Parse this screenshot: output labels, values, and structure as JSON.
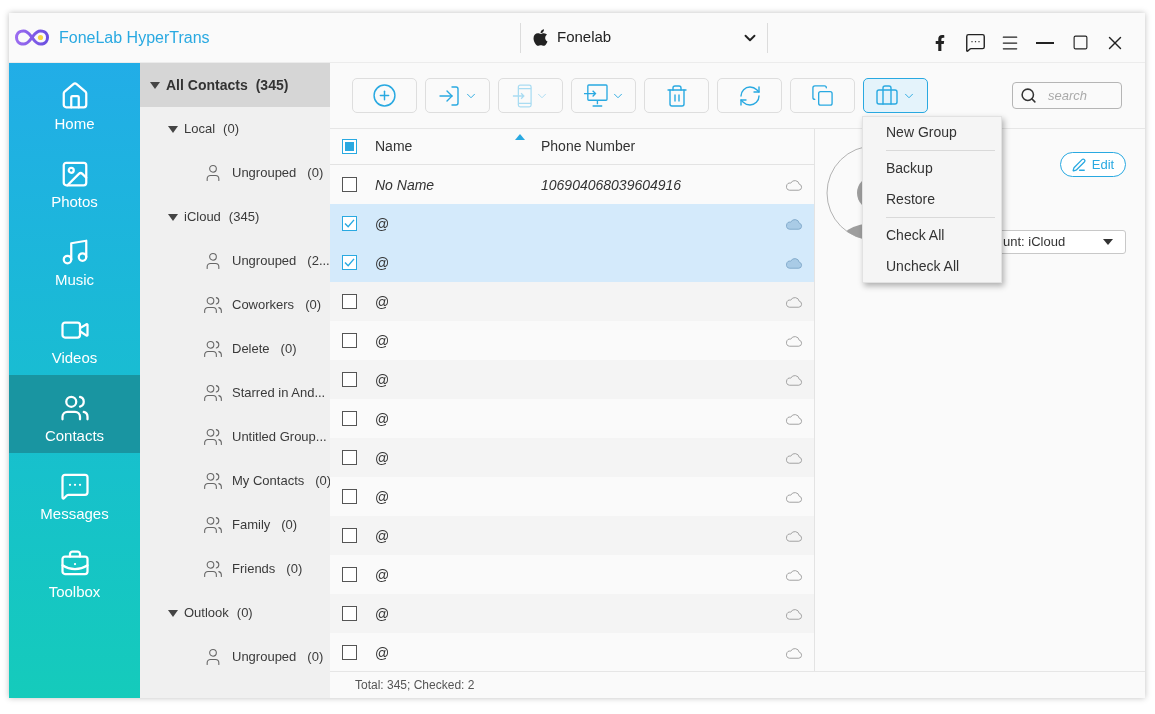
{
  "window": {
    "title": "FoneLab HyperTrans"
  },
  "device": {
    "name": "Fonelab"
  },
  "nav": [
    {
      "label": "Home",
      "selected": false
    },
    {
      "label": "Photos",
      "selected": false
    },
    {
      "label": "Music",
      "selected": false
    },
    {
      "label": "Videos",
      "selected": false
    },
    {
      "label": "Contacts",
      "selected": true
    },
    {
      "label": "Messages",
      "selected": false
    },
    {
      "label": "Toolbox",
      "selected": false
    }
  ],
  "groups": [
    {
      "label": "All Contacts",
      "count": "(345)",
      "selected": true,
      "expanded": true,
      "children": [
        {
          "label": "Local",
          "count": "(0)",
          "selected": false,
          "expanded": true,
          "children": [
            {
              "label": "Ungrouped",
              "count": "(0)",
              "kind": "ungrouped",
              "selected": false
            }
          ]
        },
        {
          "label": "iCloud",
          "count": "(345)",
          "selected": false,
          "expanded": true,
          "children": [
            {
              "label": "Ungrouped",
              "count": "(2...",
              "kind": "ungrouped",
              "selected": false
            },
            {
              "label": "Coworkers",
              "count": "(0)",
              "kind": "group",
              "selected": false
            },
            {
              "label": "Delete",
              "count": "(0)",
              "kind": "group",
              "selected": false
            },
            {
              "label": "Starred in And...",
              "kind": "group",
              "selected": false
            },
            {
              "label": "Untitled Group...",
              "kind": "group",
              "selected": false
            },
            {
              "label": "My Contacts",
              "count": "(0)",
              "kind": "group",
              "selected": false
            },
            {
              "label": "Family",
              "count": "(0)",
              "kind": "group",
              "selected": false
            },
            {
              "label": "Friends",
              "count": "(0)",
              "kind": "group",
              "selected": false
            }
          ]
        },
        {
          "label": "Outlook",
          "count": "(0)",
          "selected": false,
          "expanded": true,
          "children": [
            {
              "label": "Ungrouped",
              "count": "(0)",
              "kind": "ungrouped",
              "selected": false
            }
          ]
        }
      ]
    }
  ],
  "toolbar": {
    "buttons": [
      {
        "menu": false,
        "disabled": false,
        "active": false
      },
      {
        "menu": true,
        "disabled": false,
        "active": false
      },
      {
        "menu": true,
        "disabled": true,
        "active": false
      },
      {
        "menu": true,
        "disabled": false,
        "active": false
      },
      {
        "menu": false,
        "disabled": false,
        "active": false
      },
      {
        "menu": false,
        "disabled": false,
        "active": false
      },
      {
        "menu": false,
        "disabled": false,
        "active": false
      },
      {
        "menu": true,
        "disabled": false,
        "active": true
      }
    ],
    "search": {
      "placeholder": "search"
    }
  },
  "table": {
    "select_all": {
      "indeterminate": true
    },
    "columns": [
      {
        "label": "Name",
        "sorted": true
      },
      {
        "label": "Phone Number",
        "sorted": false
      }
    ],
    "rows": [
      {
        "kind": "unnamed",
        "name": "No Name",
        "phone": "106904068039604916",
        "checked": false
      },
      {
        "kind": "contact",
        "name": "@",
        "checked": true
      },
      {
        "kind": "contact",
        "name": "@",
        "checked": true
      },
      {
        "kind": "contact",
        "name": "@",
        "checked": false
      },
      {
        "kind": "contact",
        "name": "@",
        "checked": false
      },
      {
        "kind": "contact",
        "name": "@",
        "checked": false
      },
      {
        "kind": "contact",
        "name": "@",
        "checked": false
      },
      {
        "kind": "contact",
        "name": "@",
        "checked": false
      },
      {
        "kind": "contact",
        "name": "@",
        "checked": false
      },
      {
        "kind": "contact",
        "name": "@",
        "checked": false
      },
      {
        "kind": "contact",
        "name": "@",
        "checked": false
      },
      {
        "kind": "contact",
        "name": "@",
        "checked": false
      },
      {
        "kind": "contact",
        "name": "@",
        "checked": false
      }
    ]
  },
  "detail": {
    "edit_button": "Edit",
    "account": "unt: iCloud"
  },
  "menu": {
    "sections": [
      {
        "items": [
          {
            "label": "New Group"
          }
        ]
      },
      {
        "items": [
          {
            "label": "Backup"
          },
          {
            "label": "Restore"
          }
        ]
      },
      {
        "items": [
          {
            "label": "Check All"
          },
          {
            "label": "Uncheck All"
          }
        ]
      }
    ]
  },
  "status_bar": "Total: 345; Checked: 2"
}
